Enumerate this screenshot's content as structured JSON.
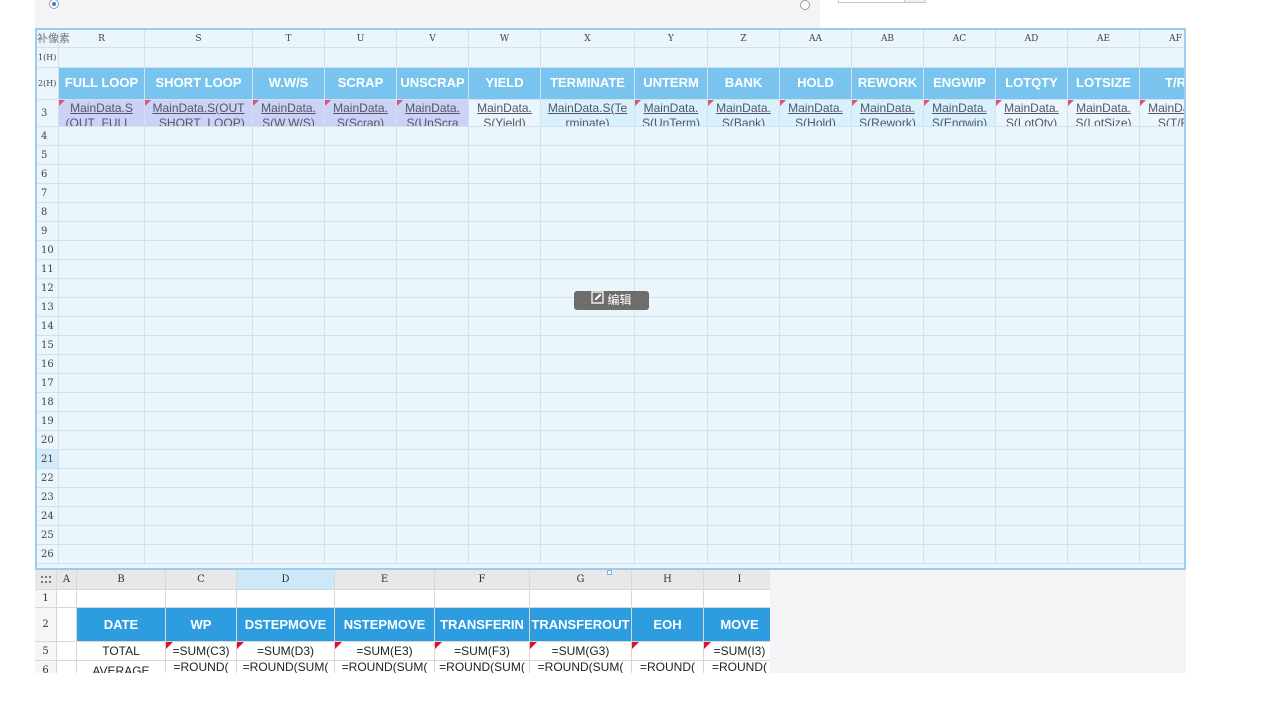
{
  "upper_sheet": {
    "corner_label": "补像素",
    "columns": [
      "R",
      "S",
      "T",
      "U",
      "V",
      "W",
      "X",
      "Y",
      "Z",
      "AA",
      "AB",
      "AC",
      "AD",
      "AE",
      "AF"
    ],
    "row1_label": "1(H)",
    "row2_label": "2(H)",
    "header_row": [
      "FULL LOOP",
      "SHORT LOOP",
      "W.W/S",
      "SCRAP",
      "UNSCRAP",
      "YIELD",
      "TERMINATE",
      "UNTERM",
      "BANK",
      "HOLD",
      "REWORK",
      "ENGWIP",
      "LOTQTY",
      "LOTSIZE",
      "T/R"
    ],
    "row3_label": "3",
    "row3_values": [
      "MainData.S(OUT_FULL_LOOP)",
      "MainData.S(OUT_SHORT_LOOP)",
      "MainData.S(W.W/S)",
      "MainData.S(Scrap)",
      "MainData.S(UnScrap)",
      "MainData.S(Yield)",
      "MainData.S(Terminate)",
      "MainData.S(UnTerm)",
      "MainData.S(Bank)",
      "MainData.S(Hold)",
      "MainData.S(Rework)",
      "MainData.S(Engwip)",
      "MainData.S(LotQty)",
      "MainData.S(LotSize)",
      "MainData.S(T/R)"
    ],
    "row3_styles": [
      "lav",
      "lav",
      "lav",
      "lav",
      "lav",
      "light",
      "cyan",
      "cyan",
      "cyan",
      "cyan",
      "cyan",
      "cyan",
      "light",
      "light",
      "light"
    ],
    "row_numbers": [
      "4",
      "5",
      "6",
      "7",
      "8",
      "9",
      "10",
      "11",
      "12",
      "13",
      "14",
      "15",
      "16",
      "17",
      "18",
      "19",
      "20",
      "21",
      "22",
      "23",
      "24",
      "25",
      "26"
    ],
    "selected_row": "21",
    "edit_button": "编辑"
  },
  "lower_sheet": {
    "columns": [
      "A",
      "B",
      "C",
      "D",
      "E",
      "F",
      "G",
      "H",
      "I"
    ],
    "selected_column": "D",
    "row_labels": [
      "1",
      "2",
      "5",
      "6"
    ],
    "header_row": [
      "DATE",
      "WP",
      "DSTEPMOVE",
      "NSTEPMOVE",
      "TRANSFERIN",
      "TRANSFEROUT",
      "EOH",
      "MOVE"
    ],
    "total_row": [
      "TOTAL",
      "=SUM(C3)",
      "=SUM(D3)",
      "=SUM(E3)",
      "=SUM(F3)",
      "=SUM(G3)",
      "",
      "=SUM(I3)"
    ],
    "average_row": [
      "AVERAGE",
      "=ROUND(",
      "=ROUND(SUM(",
      "=ROUND(SUM(",
      "=ROUND(SUM(",
      "=ROUND(SUM(",
      "=ROUND(",
      "=ROUND("
    ]
  },
  "colors": {
    "upper_header": "#78c4ee",
    "lower_header": "#2e9de0",
    "selection_border": "#9ccbf0"
  }
}
